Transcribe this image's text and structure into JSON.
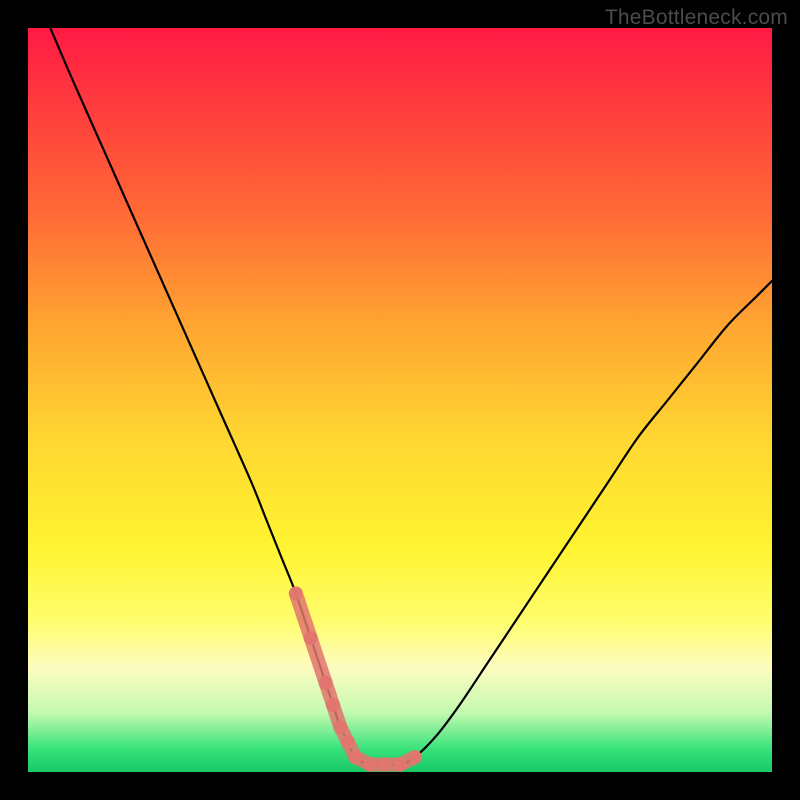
{
  "watermark": "TheBottleneck.com",
  "chart_data": {
    "type": "line",
    "title": "",
    "xlabel": "",
    "ylabel": "",
    "xlim": [
      0,
      100
    ],
    "ylim": [
      0,
      100
    ],
    "grid": false,
    "legend": false,
    "annotations": [],
    "series": [
      {
        "name": "bottleneck-curve",
        "color": "#000000",
        "x": [
          3,
          6,
          10,
          14,
          18,
          22,
          26,
          30,
          32,
          34,
          36,
          38,
          40,
          41,
          42,
          43,
          44,
          46,
          48,
          50,
          52,
          55,
          58,
          62,
          66,
          70,
          74,
          78,
          82,
          86,
          90,
          94,
          98,
          100
        ],
        "y": [
          100,
          93,
          84,
          75,
          66,
          57,
          48,
          39,
          34,
          29,
          24,
          18,
          12,
          9,
          6,
          4,
          2,
          1,
          1,
          1,
          2,
          5,
          9,
          15,
          21,
          27,
          33,
          39,
          45,
          50,
          55,
          60,
          64,
          66
        ]
      },
      {
        "name": "optimal-zone",
        "color": "#e2766f",
        "style": "thick-dash",
        "x": [
          36,
          38,
          40,
          41,
          42,
          43,
          44,
          46,
          48,
          50,
          52
        ],
        "y": [
          24,
          18,
          12,
          9,
          6,
          4,
          2,
          1,
          1,
          1,
          2
        ]
      }
    ],
    "notes": "Axes are unlabeled in the image; x is normalized 0-100 left-to-right and y is normalized 0-100 where 0 = bottom (green / no bottleneck) and 100 = top (red / severe bottleneck). Values are estimated from the rendered curve."
  }
}
